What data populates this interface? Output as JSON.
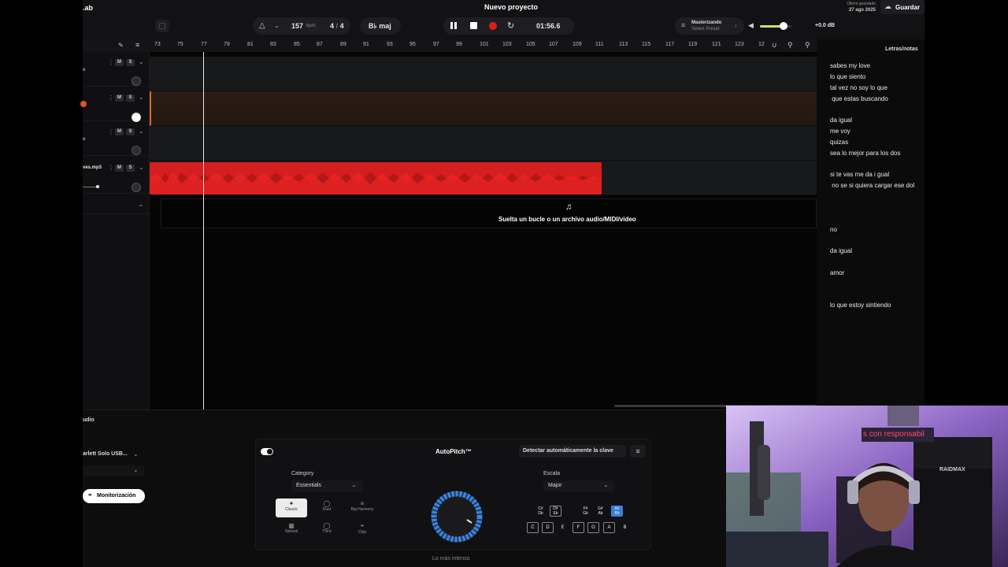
{
  "app": {
    "logo_fragment": ".ab",
    "title": "Nuevo proyecto"
  },
  "header": {
    "bpm_value": "157",
    "bpm_unit": "bpm",
    "time_sig_num": "4",
    "time_sig_sep": "/",
    "time_sig_den": "4",
    "key": "B♭ maj",
    "time_display": "01:56.6",
    "mastering_label": "Masterizando",
    "mastering_preset": "Select Preset",
    "master_volume": "+0.0 dB",
    "volume_level": 0.75,
    "saved_label": "Último guardado",
    "saved_date": "27 ago 2025",
    "save_button": "Guardar"
  },
  "ruler": {
    "bars": [
      "73",
      "75",
      "77",
      "79",
      "81",
      "83",
      "85",
      "87",
      "89",
      "91",
      "93",
      "95",
      "97",
      "99",
      "101",
      "103",
      "105",
      "107",
      "109",
      "111",
      "113",
      "115",
      "117",
      "119",
      "121",
      "123",
      "12"
    ]
  },
  "tracks": [
    {
      "name": "o",
      "mute": "M",
      "solo": "S"
    },
    {
      "name": "",
      "mute": "M",
      "solo": "S"
    },
    {
      "name": "o",
      "mute": "M",
      "solo": "S"
    },
    {
      "name": "ves.mp3",
      "mute": "M",
      "solo": "S"
    }
  ],
  "arrange": {
    "drop_hint": "Suelta un bucle o un archivo audio/MIDI/video"
  },
  "lyrics": {
    "title": "Letras/notas",
    "lines": [
      "sabes my love",
      "lo que siento",
      "tal vez no soy lo que",
      " que estas buscando",
      "da igual",
      "me voy",
      "quizas",
      "sea lo mejor para los dos",
      "si te vas me da i gual",
      " no se si quiera cargar ese dol",
      "no",
      "da igual",
      "amor",
      "lo que estoy sintiendo"
    ]
  },
  "bottom": {
    "section_label": "udio",
    "input_device": "arlett Solo USB...",
    "monitor_button": "Monitorización"
  },
  "autopitch": {
    "title": "AutoPitch™",
    "detect_button": "Detectar automáticamente la clave",
    "category_label": "Category",
    "category_value": "Essentials",
    "modes": [
      "Classic",
      "Duet",
      "Big Harmony",
      "Natural",
      "Third",
      "Chip"
    ],
    "knob_label": "Lo más intenso",
    "scale_label": "Escala",
    "scale_value": "Major",
    "sharps": [
      "C#\nDb",
      "D#\nEb",
      "F#\nGb",
      "G#\nAb",
      "A#\nBb"
    ],
    "naturals": [
      "C",
      "D",
      "E",
      "F",
      "G",
      "A",
      "B"
    ]
  },
  "webcam": {
    "neon_text": "s con responsabil",
    "chair_brand": "RAIDMAX"
  }
}
